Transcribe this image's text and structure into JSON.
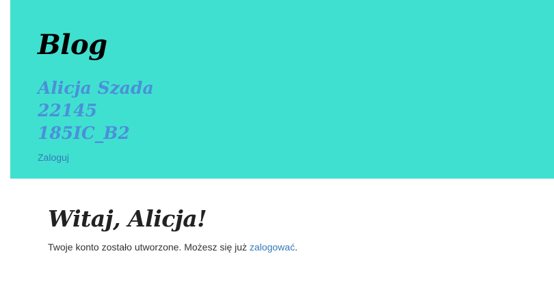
{
  "header": {
    "blog_title": "Blog",
    "author_lines": [
      "Alicja Szada",
      "22145",
      "185IC_B2"
    ],
    "login_link": "Zaloguj",
    "background_color": "#40e0d0"
  },
  "main": {
    "welcome_title": "Witaj, Alicja!",
    "message_prefix": "Twoje konto zostało utworzone. Możesz się już ",
    "message_link": "zalogować",
    "message_suffix": "."
  }
}
